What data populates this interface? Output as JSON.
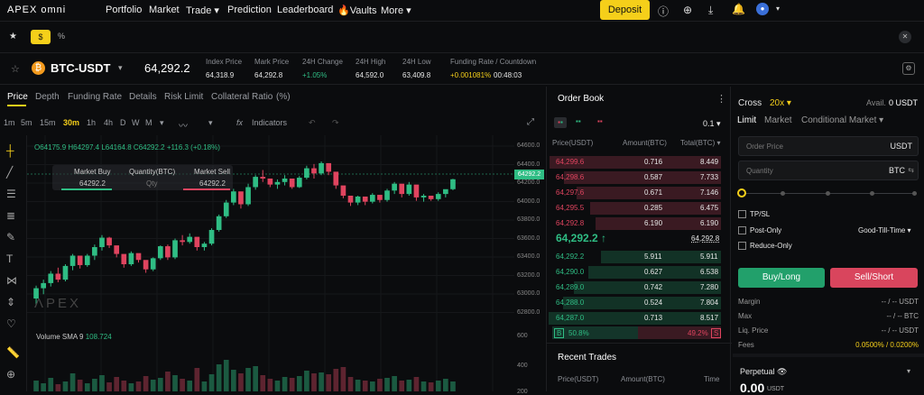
{
  "nav": {
    "brand": "APEX omni",
    "items": [
      "Portfolio",
      "Market",
      "Trade",
      "Prediction",
      "Leaderboard",
      "Vaults",
      "More"
    ],
    "deposit": "Deposit"
  },
  "tabbar": {
    "star": "★",
    "dollar": "$",
    "percent": "%"
  },
  "ticker": {
    "pair": "BTC-USDT",
    "price": "64,292.2",
    "index_label": "Index Price",
    "index": "64,318.9",
    "mark_label": "Mark Price",
    "mark": "64,292.8",
    "change_label": "24H Change",
    "change": "+1.05%",
    "high_label": "24H High",
    "high": "64,592.0",
    "low_label": "24H Low",
    "low": "63,409.8",
    "funding_label": "Funding Rate / Countdown",
    "funding_rate": "+0.001081%",
    "countdown": "00:48:03"
  },
  "subtabs": [
    "Price",
    "Depth",
    "Funding Rate",
    "Details",
    "Risk Limit",
    "Collateral Ratio",
    "(%)"
  ],
  "timeframes": [
    "1m",
    "5m",
    "15m",
    "30m",
    "1h",
    "4h",
    "D",
    "W",
    "M"
  ],
  "indicators_label": "Indicators",
  "ohlc": {
    "o": "O64175.9",
    "h": "H64297.4",
    "l": "L64164.8",
    "c": "C64292.2",
    "chg": "+116.3 (+0.18%)"
  },
  "quick": {
    "buy": "Market Buy",
    "buy_val": "64292.2",
    "qty": "Quantity(BTC)",
    "qty_ph": "Qty",
    "sell": "Market Sell",
    "sell_val": "64292.2"
  },
  "volume": {
    "label": "Volume SMA 9",
    "value": "108.724"
  },
  "axis": [
    "64600.0",
    "64400.0",
    "64200.0",
    "64000.0",
    "63800.0",
    "63600.0",
    "63400.0",
    "63200.0",
    "63000.0",
    "62800.0"
  ],
  "axis_current": "64292.2",
  "vol_axis": [
    "600",
    "400",
    "200"
  ],
  "orderbook": {
    "title": "Order Book",
    "step": "0.1",
    "headers": [
      "Price(USDT)",
      "Amount(BTC)",
      "Total(BTC)"
    ],
    "asks": [
      [
        "64,299.6",
        "0.716",
        "8.449"
      ],
      [
        "64,298.6",
        "0.587",
        "7.733"
      ],
      [
        "64,297.6",
        "0.671",
        "7.146"
      ],
      [
        "64,295.5",
        "0.285",
        "6.475"
      ],
      [
        "64,292.8",
        "6.190",
        "6.190"
      ]
    ],
    "mid": "64,292.2 ↑",
    "mid_mark": "64,292.8",
    "bids": [
      [
        "64,292.2",
        "5.911",
        "5.911"
      ],
      [
        "64,290.0",
        "0.627",
        "6.538"
      ],
      [
        "64,289.0",
        "0.742",
        "7.280"
      ],
      [
        "64,288.0",
        "0.524",
        "7.804"
      ],
      [
        "64,287.0",
        "0.713",
        "8.517"
      ]
    ],
    "ratio_b": "B",
    "ratio_buy": "50.8%",
    "ratio_sell": "49.2%",
    "ratio_s": "S",
    "recent": "Recent Trades",
    "recent_headers": [
      "Price(USDT)",
      "Amount(BTC)",
      "Time"
    ]
  },
  "trade": {
    "margin_mode": "Cross",
    "leverage": "20x",
    "avail_label": "Avail.",
    "avail": "0 USDT",
    "types": [
      "Limit",
      "Market",
      "Conditional Market"
    ],
    "order_price": "Order Price",
    "usdt": "USDT",
    "qty": "Quantity",
    "btc": "BTC",
    "tpsl": "TP/SL",
    "post_only": "Post-Only",
    "reduce_only": "Reduce-Only",
    "tif": "Good-Till-Time",
    "buy": "Buy/Long",
    "sell": "Sell/Short",
    "info": [
      [
        "Margin",
        "-- / -- USDT"
      ],
      [
        "Max",
        "-- / -- BTC"
      ],
      [
        "Liq. Price",
        "-- / -- USDT"
      ],
      [
        "Fees",
        "0.0500% / 0.0200%"
      ]
    ],
    "perp": "Perpetual",
    "perp_val": "0.00",
    "perp_unit": "USDT"
  },
  "chart_data": {
    "type": "candlestick",
    "ylim": [
      62700,
      64700
    ],
    "candles": [
      [
        62900,
        63050,
        62820,
        63020
      ],
      [
        63020,
        63120,
        62950,
        63080
      ],
      [
        63080,
        63220,
        63040,
        63190
      ],
      [
        63190,
        63260,
        63090,
        63120
      ],
      [
        63120,
        63300,
        63100,
        63280
      ],
      [
        63280,
        63420,
        63230,
        63400
      ],
      [
        63400,
        63380,
        63250,
        63290
      ],
      [
        63290,
        63420,
        63270,
        63400
      ],
      [
        63400,
        63530,
        63350,
        63500
      ],
      [
        63500,
        63640,
        63460,
        63610
      ],
      [
        63610,
        63620,
        63490,
        63520
      ],
      [
        63520,
        63500,
        63380,
        63420
      ],
      [
        63420,
        63390,
        63260,
        63300
      ],
      [
        63300,
        63450,
        63280,
        63430
      ],
      [
        63430,
        63410,
        63320,
        63350
      ],
      [
        63350,
        63330,
        63200,
        63240
      ],
      [
        63240,
        63380,
        63220,
        63370
      ],
      [
        63370,
        63520,
        63350,
        63510
      ],
      [
        63510,
        63530,
        63350,
        63380
      ],
      [
        63380,
        63600,
        63360,
        63580
      ],
      [
        63580,
        63640,
        63520,
        63560
      ],
      [
        63560,
        63660,
        63540,
        63620
      ],
      [
        63620,
        63580,
        63460,
        63500
      ],
      [
        63500,
        63560,
        63460,
        63540
      ],
      [
        63540,
        63720,
        63520,
        63700
      ],
      [
        63700,
        63880,
        63680,
        63860
      ],
      [
        63860,
        64050,
        63840,
        64020
      ],
      [
        64020,
        64180,
        63990,
        64150
      ],
      [
        64150,
        64060,
        63950,
        64000
      ],
      [
        64000,
        64240,
        63980,
        64200
      ],
      [
        64200,
        64340,
        64170,
        64320
      ],
      [
        64320,
        64400,
        64260,
        64300
      ],
      [
        64300,
        64280,
        64200,
        64230
      ],
      [
        64230,
        64290,
        64180,
        64260
      ],
      [
        64260,
        64340,
        64220,
        64300
      ],
      [
        64300,
        64250,
        64180,
        64200
      ],
      [
        64200,
        64330,
        64190,
        64310
      ],
      [
        64310,
        64450,
        64290,
        64420
      ],
      [
        64420,
        64470,
        64300,
        64360
      ],
      [
        64360,
        64500,
        64340,
        64480
      ],
      [
        64480,
        64460,
        64340,
        64380
      ],
      [
        64380,
        64300,
        64180,
        64220
      ],
      [
        64220,
        64180,
        64070,
        64100
      ],
      [
        64100,
        64060,
        63980,
        64020
      ],
      [
        64020,
        64100,
        63990,
        64090
      ],
      [
        64090,
        64070,
        63990,
        64030
      ],
      [
        64030,
        64130,
        64010,
        64110
      ],
      [
        64110,
        64080,
        64020,
        64050
      ],
      [
        64050,
        64180,
        64030,
        64160
      ],
      [
        64160,
        64260,
        64120,
        64240
      ],
      [
        64240,
        64200,
        64080,
        64120
      ],
      [
        64120,
        64260,
        64100,
        64230
      ],
      [
        64230,
        64150,
        64040,
        64080
      ],
      [
        64080,
        64120,
        64030,
        64100
      ],
      [
        64100,
        64080,
        64040,
        64060
      ],
      [
        64060,
        64140,
        64040,
        64120
      ],
      [
        64120,
        64140,
        64080,
        64176
      ],
      [
        64176,
        64297,
        64164,
        64292
      ]
    ],
    "volumes": [
      120,
      90,
      150,
      80,
      110,
      200,
      130,
      90,
      140,
      180,
      100,
      160,
      120,
      90,
      110,
      170,
      130,
      150,
      220,
      180,
      140,
      120,
      260,
      110,
      190,
      300,
      350,
      240,
      200,
      260,
      280,
      180,
      140,
      120,
      160,
      150,
      170,
      230,
      200,
      210,
      190,
      250,
      270,
      160,
      130,
      120,
      110,
      140,
      150,
      170,
      120,
      130,
      160,
      110,
      100,
      120,
      140,
      110
    ]
  }
}
